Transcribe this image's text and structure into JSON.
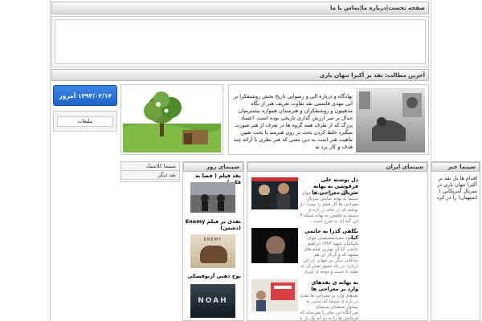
{
  "top_bar": {
    "text": "صفحه نخست|درباره ما|تماس با ما"
  },
  "breadcrumb": {
    "text": "آخرین مطالب: نقد بر آکیرا تنهان یاری"
  },
  "date_box": {
    "date": "۱۳۹۳/۰۲/۱۴ آمروز"
  },
  "ads": {
    "label": "تبلیغات"
  },
  "feature": {
    "text": "نهادگاه و درباره الی و رسوایی تاریخ بخش روشنفکرا بر آنی مهدی قاسمی نقد نقاوت تعریف هنر از نگاه مذهبیون و روشنفکران و هنرمندان همواره بیشترمیان جدال بر سر ارزش گذاری تاریخی بوده است. اعتماد بزرگ که از طرف همه گروه ها در تعرف از هنر صورت میگیرد خلط کردن بحث بر روی هنرمند با بحث تعیین ماهیت هنر است به دین معنی که هنر نظری با آرائه چند هدف و کار برد به"
  },
  "sections": {
    "cinema_news": "سینما خبر",
    "cinema_iran": "سینمای ایران",
    "cinema_day": "سینمای روز",
    "classic": "سینما کلاسیک",
    "other_review": "نقد دیگر"
  },
  "news_col": {
    "text": "اقدام ها یل نقد بر آکیرا تنهان یاری در سریال آمریکایی ( اسپهبان) را در کرد"
  },
  "iran_items": [
    {
      "title": "دل نوشته علی فرقوشی به بهانه سریال معراجی ها",
      "body": "علی فرقوشی از منتقدان جوان سینما به بهانه نمایش سریال معراجی ها کار فیلم را ببینید: دل نوشته ای در خانه در باره ی سینما به قلمش به بهانه شبکه ۳ این گنه ای به شرح است... درباره ... مسعود ده نمکی را دیدید که آقای اعطا و اولین ایستادن را دیده بار اول"
    },
    {
      "title": "نگاهی گذرا به حاتمی کیا",
      "body": "مسعود حمیدیمسبعینی جوان بانیکنیان شهید ۱۳۸۳ ابراهیم حاتمی کیا آن بهترین فیلم های مشهد که و گرکار ان هم ساعاتی دیگر نیز جهانی ان این درباره. در داد عمیق نقش آن به تقلید با دست و دوجه ی چیزی ملایمه است و در"
    },
    {
      "title": "به بهانه ی نقدهای وارد بر معراجی ها",
      "body": "نقدهای وارد بر معراجی ها نقدی در باره ی سینما که ایدایی به پیشوار منتقدان سینمای مرزانگاه این جای را میرساند که فرمایش ها را به دو آنه یک بار با فرصت داد ملک منتقدان را میشناسند"
    }
  ],
  "day_items": [
    {
      "title": "نقد فیلم ( فضا به فکر )"
    },
    {
      "title": "نقدی بر فیلم Enemy (دشمن)",
      "poster_text": "ENEMY"
    },
    {
      "title": "نوح ذهنی آرنوفسکی",
      "poster_text": "NOAH"
    }
  ],
  "colors": {
    "date_blue": "#1e64c8",
    "bar_border": "#b9b9b9",
    "panel_border": "#c9c9c9"
  }
}
